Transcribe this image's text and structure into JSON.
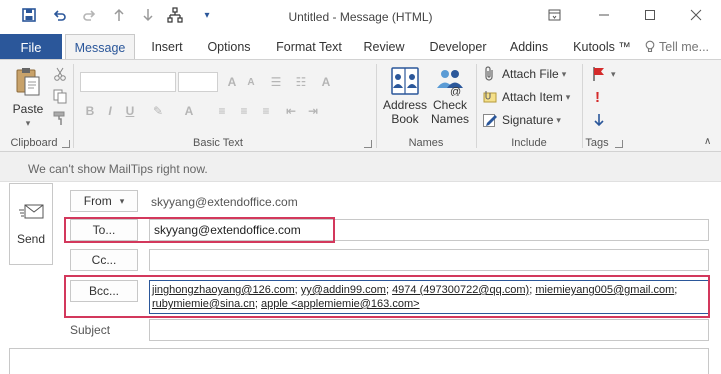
{
  "window": {
    "title": "Untitled - Message (HTML)",
    "accent": "#2b579a"
  },
  "tabs": {
    "file": "File",
    "items": [
      "Message",
      "Insert",
      "Options",
      "Format Text",
      "Review",
      "Developer",
      "Addins",
      "Kutools ™"
    ],
    "tell_me": "Tell me..."
  },
  "ribbon": {
    "clipboard": {
      "paste": "Paste",
      "label": "Clipboard"
    },
    "basic_text": {
      "label": "Basic Text"
    },
    "names": {
      "address_book_1": "Address",
      "address_book_2": "Book",
      "check_names_1": "Check",
      "check_names_2": "Names",
      "label": "Names"
    },
    "include": {
      "attach_file": "Attach File",
      "attach_item": "Attach Item",
      "signature": "Signature",
      "label": "Include"
    },
    "tags": {
      "label": "Tags"
    }
  },
  "compose": {
    "mailtips": "We can't show MailTips right now.",
    "send": "Send",
    "from_button": "From",
    "from_value": "skyyang@extendoffice.com",
    "to_button": "To...",
    "to_value": "skyyang@extendoffice.com",
    "cc_button": "Cc...",
    "bcc_button": "Bcc...",
    "bcc_line1": [
      "jinghongzhaoyang@126.com",
      "yy@addin99.com",
      "4974 (497300722@qq.com)",
      "miemieyang005@gmail.com"
    ],
    "bcc_line2": [
      "rubymiemie@sina.cn",
      "apple <applemiemie@163.com>"
    ],
    "subject_label": "Subject",
    "highlight_color": "#d3385c"
  }
}
